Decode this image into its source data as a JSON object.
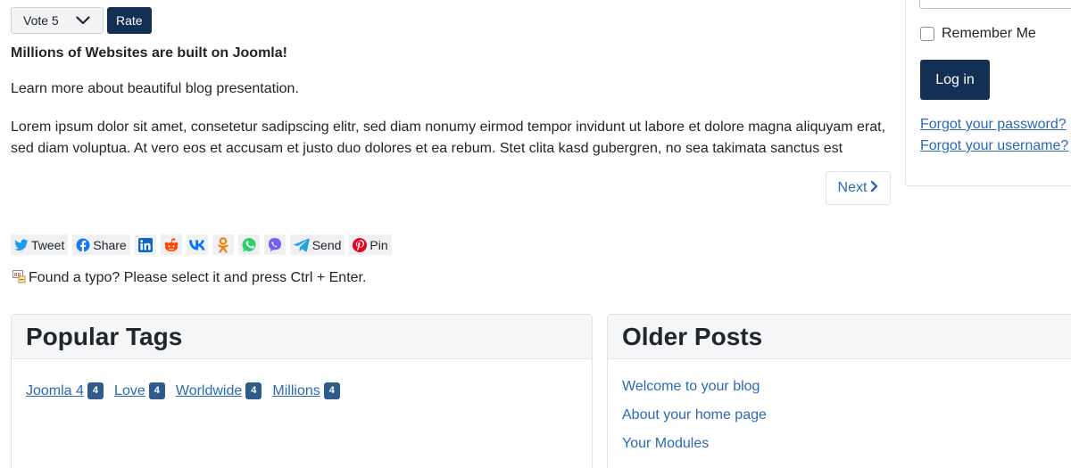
{
  "vote": {
    "selected": "Vote 5",
    "rate_label": "Rate"
  },
  "article": {
    "title": "Millions of Websites are built on Joomla!",
    "intro": "Learn more about beautiful blog presentation.",
    "body": "Lorem ipsum dolor sit amet, consetetur sadipscing elitr, sed diam nonumy eirmod tempor invidunt ut labore et dolore magna aliquyam erat, sed diam voluptua. At vero eos et accusam et justo duo dolores et ea rebum. Stet clita kasd gubergren, no sea takimata sanctus est",
    "next_label": "Next"
  },
  "share": {
    "tweet": "Tweet",
    "share": "Share",
    "send": "Send",
    "pin": "Pin",
    "icons": [
      "twitter-icon",
      "facebook-icon",
      "linkedin-icon",
      "reddit-icon",
      "vk-icon",
      "odnoklassniki-icon",
      "whatsapp-icon",
      "viber-icon",
      "telegram-icon",
      "pinterest-icon"
    ]
  },
  "typo_notice": "Found a typo? Please select it and press Ctrl + Enter.",
  "popular_tags": {
    "title": "Popular Tags",
    "tags": [
      {
        "name": "Joomla 4",
        "count": "4"
      },
      {
        "name": "Love",
        "count": "4"
      },
      {
        "name": "Worldwide",
        "count": "4"
      },
      {
        "name": "Millions",
        "count": "4"
      }
    ]
  },
  "older_posts": {
    "title": "Older Posts",
    "items": [
      "Welcome to your blog",
      "About your home page",
      "Your Modules"
    ]
  },
  "login": {
    "remember_label": "Remember Me",
    "login_label": "Log in",
    "forgot_password": "Forgot your password?",
    "forgot_username": "Forgot your username?"
  },
  "colors": {
    "primary": "#132f53",
    "link": "#2a69b8",
    "badge": "#2f5a8a"
  }
}
